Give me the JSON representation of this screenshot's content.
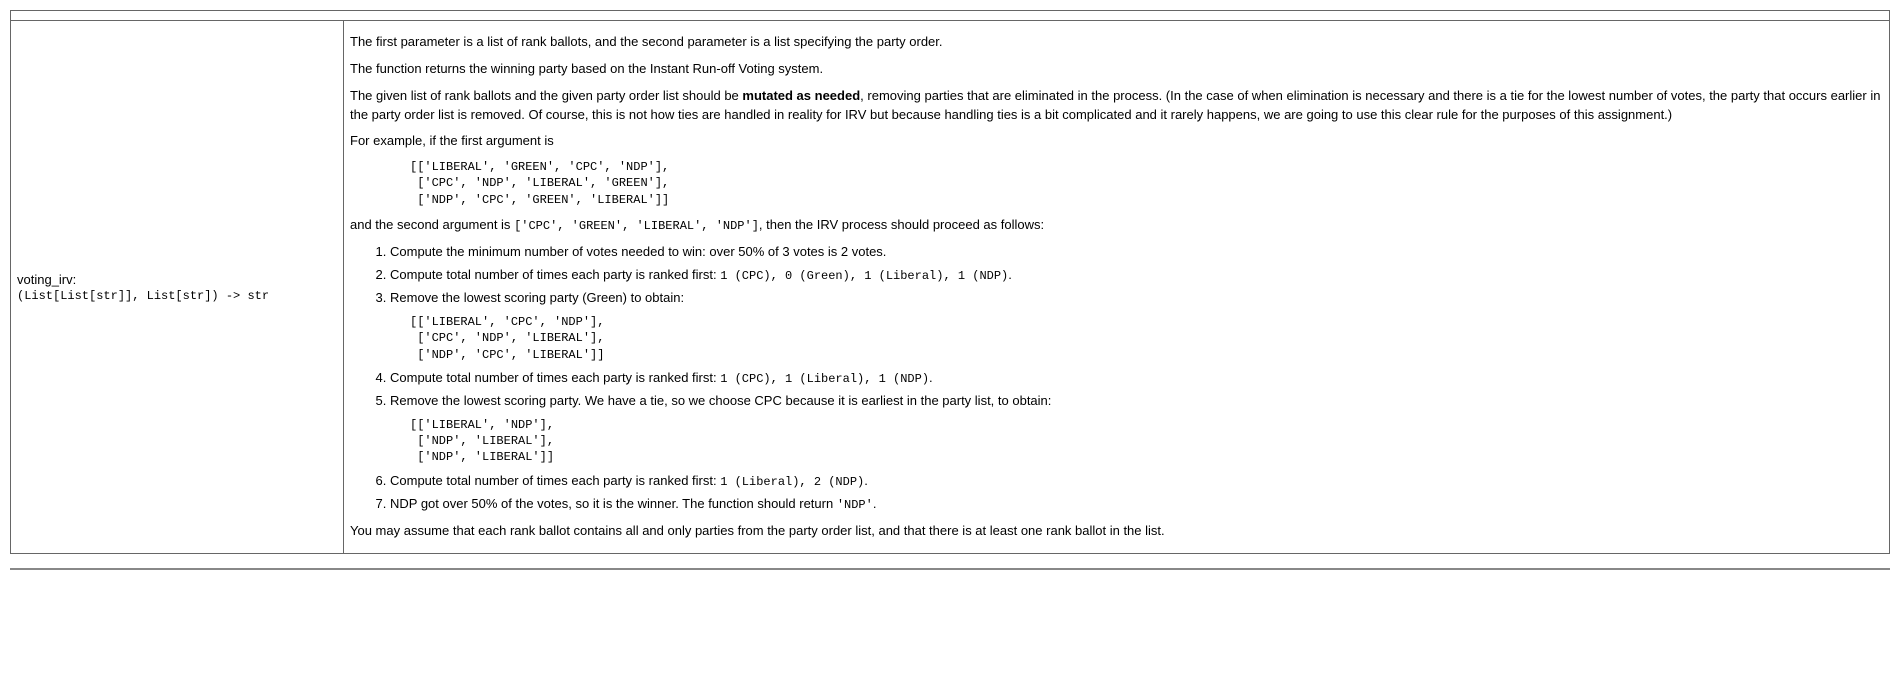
{
  "left": {
    "func_name": "voting_irv:",
    "type_sig": "(List[List[str]], List[str]) -> str"
  },
  "right": {
    "p1": "The first parameter is a list of rank ballots, and the second parameter is a list specifying the party order.",
    "p2": "The function returns the winning party based on the Instant Run-off Voting system.",
    "p3a": "The given list of rank ballots and the given party order list should be ",
    "p3b": "mutated as needed",
    "p3c": ", removing parties that are eliminated in the process. (In the case of when elimination is necessary and there is a tie for the lowest number of votes, the party that occurs earlier in the party order list is removed. Of course, this is not how ties are handled in reality for IRV but because handling ties is a bit complicated and it rarely happens, we are going to use this clear rule for the purposes of this assignment.)",
    "p4": "For example, if the first argument is",
    "codeblock1": "[['LIBERAL', 'GREEN', 'CPC', 'NDP'],\n ['CPC', 'NDP', 'LIBERAL', 'GREEN'],\n ['NDP', 'CPC', 'GREEN', 'LIBERAL']]",
    "p5a": "and the second argument is ",
    "p5code": "['CPC', 'GREEN', 'LIBERAL', 'NDP']",
    "p5b": ", then the IRV process should proceed as follows:",
    "li1": "Compute the minimum number of votes needed to win: over 50% of 3 votes is 2 votes.",
    "li2a": "Compute total number of times each party is ranked first: ",
    "li2code": "1 (CPC), 0 (Green), 1 (Liberal), 1 (NDP)",
    "li2b": ".",
    "li3": "Remove the lowest scoring party (Green) to obtain:",
    "codeblock2": "[['LIBERAL', 'CPC', 'NDP'],\n ['CPC', 'NDP', 'LIBERAL'],\n ['NDP', 'CPC', 'LIBERAL']]",
    "li4a": "Compute total number of times each party is ranked first: ",
    "li4code": "1 (CPC), 1 (Liberal), 1 (NDP)",
    "li4b": ".",
    "li5": "Remove the lowest scoring party. We have a tie, so we choose CPC because it is earliest in the party list, to obtain:",
    "codeblock3": "[['LIBERAL', 'NDP'],\n ['NDP', 'LIBERAL'],\n ['NDP', 'LIBERAL']]",
    "li6a": "Compute total number of times each party is ranked first: ",
    "li6code": "1 (Liberal), 2 (NDP)",
    "li6b": ".",
    "li7a": "NDP got over 50% of the votes, so it is the winner. The function should return ",
    "li7code": "'NDP'",
    "li7b": ".",
    "p6": "You may assume that each rank ballot contains all and only parties from the party order list, and that there is at least one rank ballot in the list."
  }
}
